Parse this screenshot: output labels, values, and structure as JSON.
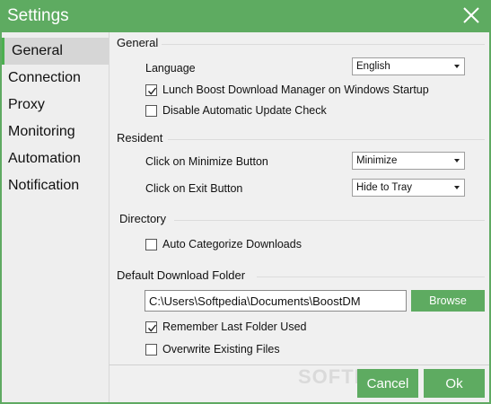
{
  "window": {
    "title": "Settings"
  },
  "sidebar": {
    "items": [
      {
        "label": "General",
        "active": true
      },
      {
        "label": "Connection"
      },
      {
        "label": "Proxy"
      },
      {
        "label": "Monitoring"
      },
      {
        "label": "Automation"
      },
      {
        "label": "Notification"
      }
    ]
  },
  "general": {
    "title": "General",
    "language_label": "Language",
    "language_value": "English",
    "startup_label": "Lunch Boost Download Manager on Windows Startup",
    "startup_checked": true,
    "auto_update_label": "Disable Automatic Update Check",
    "auto_update_checked": false
  },
  "resident": {
    "title": "Resident",
    "minimize_label": "Click on Minimize Button",
    "minimize_value": "Minimize",
    "exit_label": "Click on Exit Button",
    "exit_value": "Hide to Tray"
  },
  "directory": {
    "title": "Directory",
    "auto_categorize_label": "Auto Categorize Downloads",
    "auto_categorize_checked": false
  },
  "download_folder": {
    "title": "Default Download Folder",
    "path": "C:\\Users\\Softpedia\\Documents\\BoostDM",
    "browse_label": "Browse",
    "remember_label": "Remember Last Folder Used",
    "remember_checked": true,
    "overwrite_label": "Overwrite Existing Files",
    "overwrite_checked": false
  },
  "footer": {
    "cancel_label": "Cancel",
    "ok_label": "Ok",
    "watermark": "SOFTPEDIA"
  },
  "colors": {
    "accent": "#5eab61",
    "sidebar_active_bar": "#4caf50"
  }
}
